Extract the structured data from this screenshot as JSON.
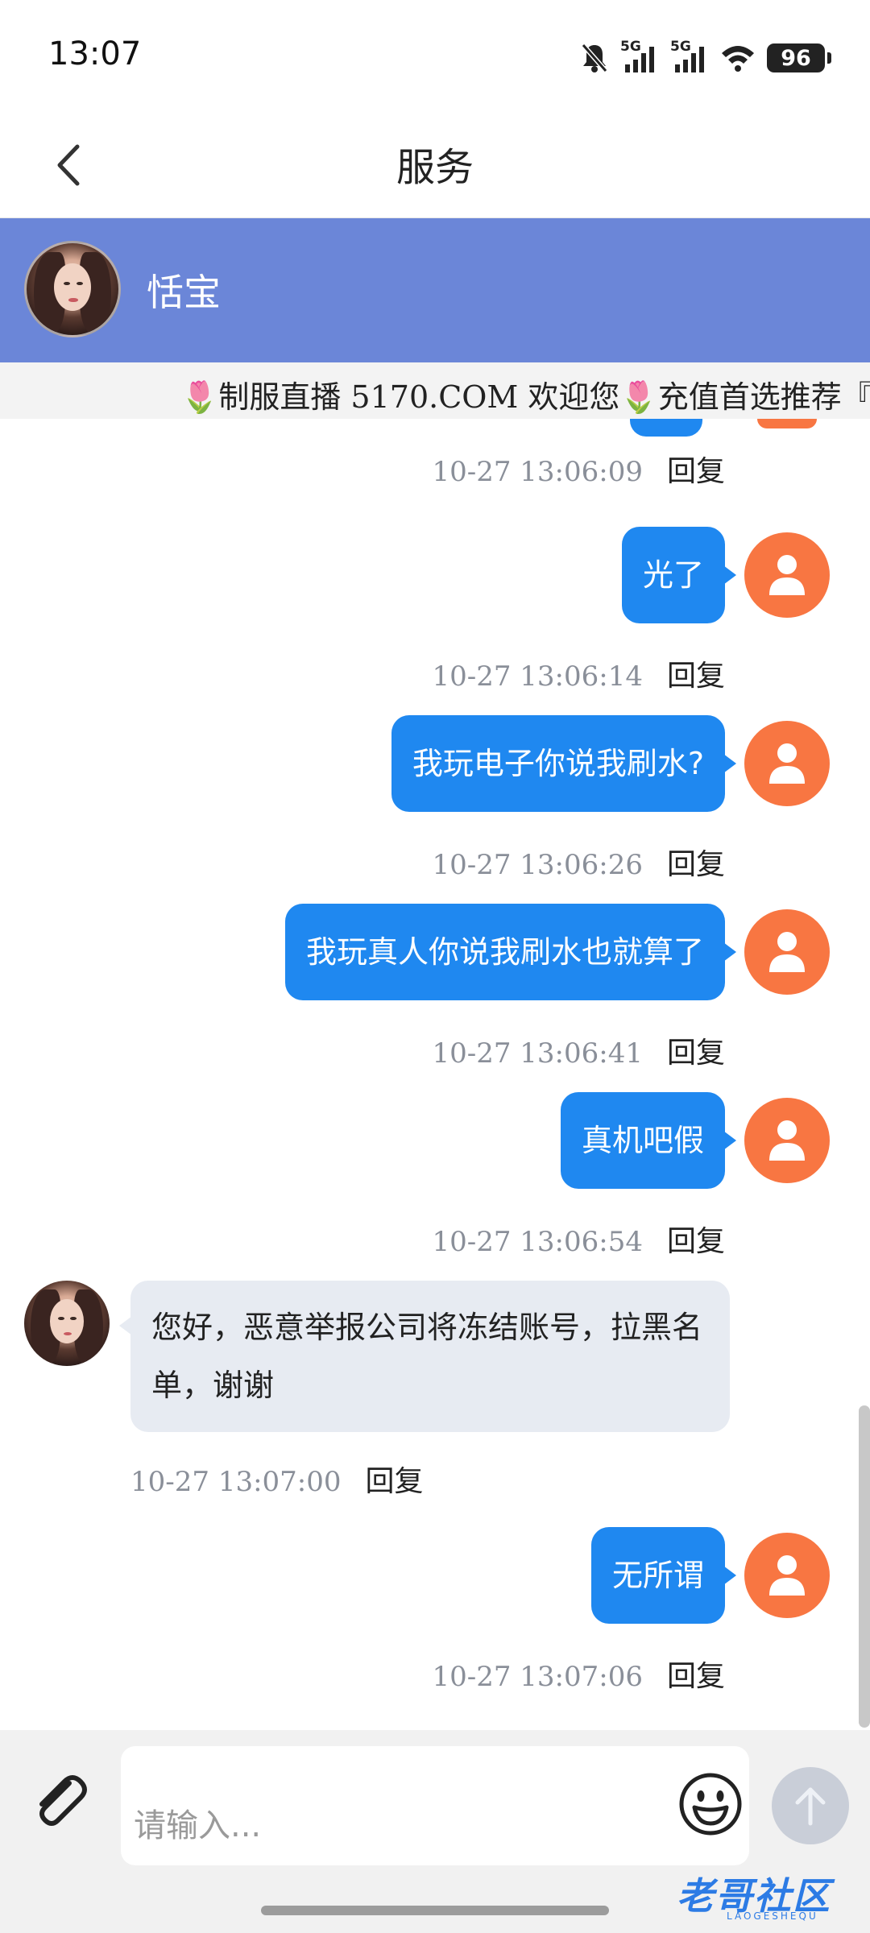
{
  "status_bar": {
    "time": "13:07",
    "network_1": "5G",
    "network_2": "5G",
    "battery": "96"
  },
  "header": {
    "title": "服务",
    "back_icon": "chevron-left-icon"
  },
  "profile": {
    "name": "恬宝"
  },
  "announcement": {
    "text": "制服直播 5170.COM 欢迎您",
    "text_2": "充值首选推荐『"
  },
  "messages": [
    {
      "time": "10-27 13:06:09",
      "reply": "回复"
    },
    {
      "text": "光了",
      "time": "10-27 13:06:14",
      "reply": "回复"
    },
    {
      "text": "我玩电子你说我刷水?",
      "time": "10-27 13:06:26",
      "reply": "回复"
    },
    {
      "text": "我玩真人你说我刷水也就算了",
      "time": "10-27 13:06:41",
      "reply": "回复"
    },
    {
      "text": "真机吧假",
      "time": "10-27 13:06:54",
      "reply": "回复"
    },
    {
      "text": "您好，恶意举报公司将冻结账号，拉黑名单，谢谢",
      "time": "10-27 13:07:00",
      "reply": "回复"
    },
    {
      "text": "无所谓",
      "time": "10-27 13:07:06",
      "reply": "回复"
    }
  ],
  "composer": {
    "placeholder": "请输入...",
    "attach_icon": "paperclip-icon",
    "emoji_icon": "smiley-icon",
    "send_icon": "arrow-up-icon"
  },
  "watermark": {
    "text": "老哥社区",
    "sub": "LAOGESHEQU"
  },
  "colors": {
    "banner": "#6b86d8",
    "bubble_out": "#1f88f0",
    "bubble_in": "#e7ebf2",
    "user_avatar": "#f87642"
  }
}
